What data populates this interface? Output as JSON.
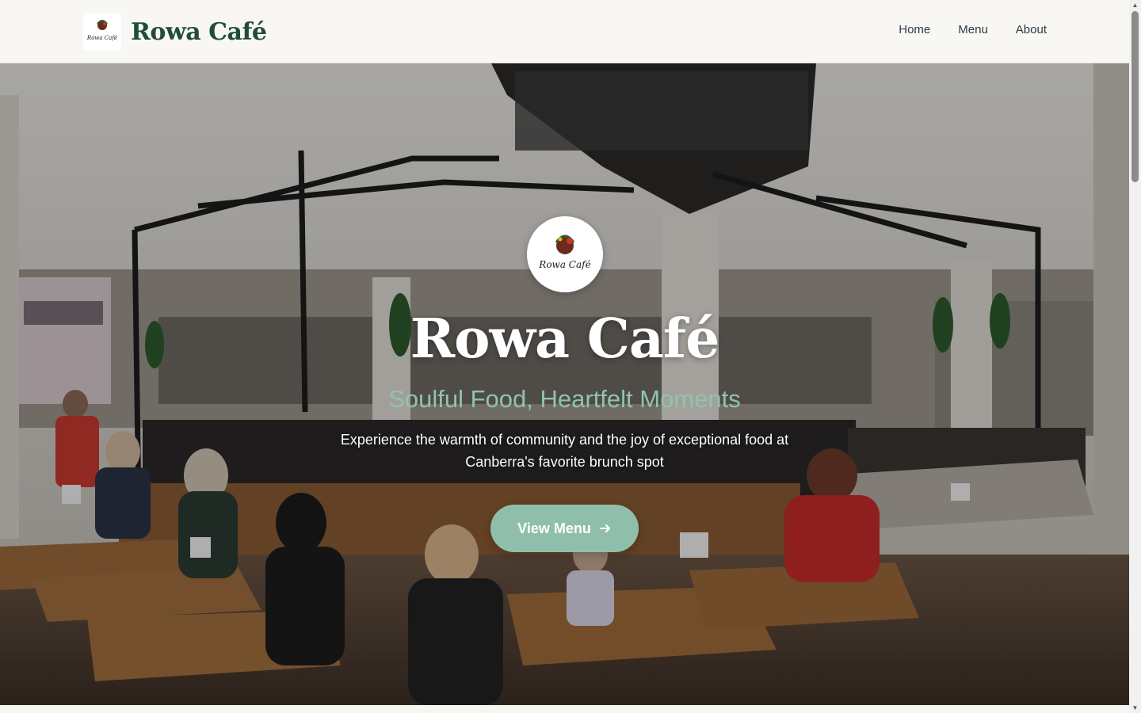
{
  "header": {
    "brand_name": "Rowa Café",
    "logo_text": "Rowa Café",
    "nav": [
      "Home",
      "Menu",
      "About"
    ]
  },
  "hero": {
    "logo_text": "Rowa Café",
    "title": "Rowa Café",
    "tagline": "Soulful Food, Heartfelt Moments",
    "description": "Experience the warmth of community and the joy of exceptional food at Canberra's favorite brunch spot",
    "cta_label": "View Menu",
    "cta_icon": "arrow-right-icon"
  },
  "colors": {
    "brand_green": "#1f4d3a",
    "accent_sage": "#8fbfab",
    "tagline": "#8fc4ad",
    "header_bg": "#f8f7f4"
  }
}
